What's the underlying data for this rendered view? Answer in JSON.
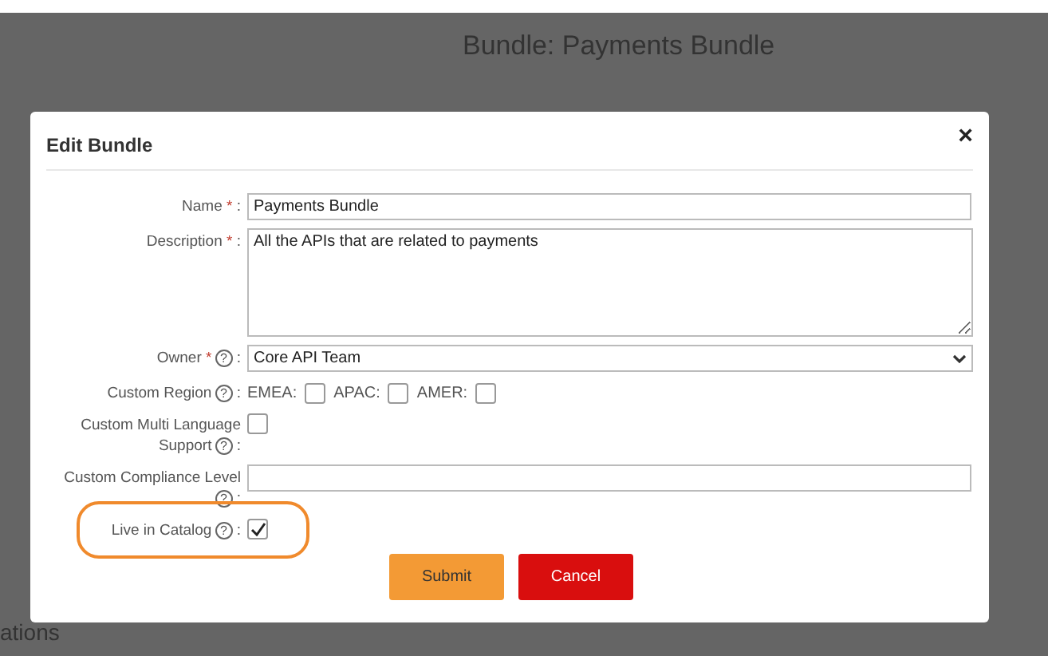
{
  "background": {
    "page_title": "Bundle: Payments Bundle",
    "section_heading": "ations"
  },
  "dialog": {
    "title": "Edit Bundle",
    "close": "×",
    "fields": [
      {
        "kind": "text",
        "label": "Name",
        "required_mark": "*",
        "colon": ":",
        "value": "Payments Bundle"
      },
      {
        "kind": "textarea",
        "label": "Description",
        "required_mark": "*",
        "colon": ":",
        "value": "All the APIs that are related to payments"
      },
      {
        "kind": "select",
        "label": "Owner",
        "required_mark": "*",
        "help": "?",
        "colon": ":",
        "value": "Core API Team"
      },
      {
        "kind": "checkboxes",
        "label": "Custom Region",
        "help": "?",
        "colon": ":",
        "options": [
          {
            "label": "EMEA:",
            "checked": false
          },
          {
            "label": "APAC:",
            "checked": false
          },
          {
            "label": "AMER:",
            "checked": false
          }
        ]
      },
      {
        "kind": "checkbox",
        "label": "Custom Multi Language Support",
        "help": "?",
        "colon": ":",
        "checked": false
      },
      {
        "kind": "text",
        "label": "Custom Compliance Level",
        "help": "?",
        "colon": ":"
      },
      {
        "kind": "checkbox",
        "label": "Live in Catalog",
        "help": "?",
        "colon": ":",
        "checked": true,
        "highlighted": true
      }
    ],
    "buttons": [
      {
        "label": "Submit",
        "kind": "primary"
      },
      {
        "label": "Cancel",
        "kind": "danger"
      }
    ]
  }
}
